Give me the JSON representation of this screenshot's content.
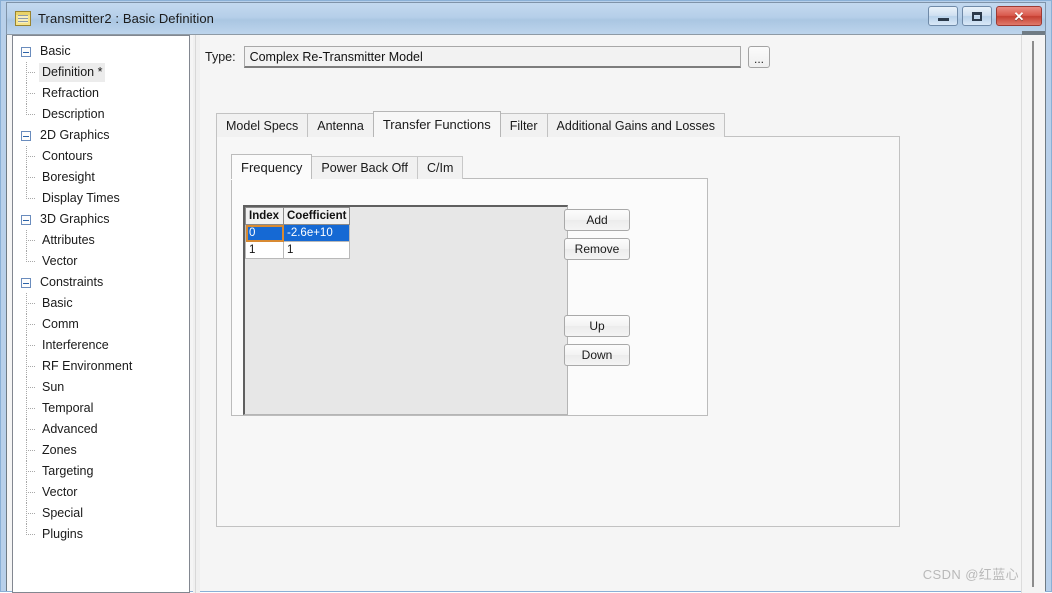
{
  "window": {
    "title": "Transmitter2 : Basic Definition",
    "icon": "notepad-icon",
    "buttons": {
      "minimize": "minimize-icon",
      "maximize": "maximize-icon",
      "close": "✕"
    },
    "frame_color": "#b8d0ea",
    "titlebar_color": "#aac6e2",
    "close_color": "#c53e31"
  },
  "sidebar": {
    "nodes": [
      {
        "label": "Basic",
        "type": "group",
        "expanded": true
      },
      {
        "label": "Definition *",
        "type": "child",
        "selected": true
      },
      {
        "label": "Refraction",
        "type": "child"
      },
      {
        "label": "Description",
        "type": "child",
        "last": true
      },
      {
        "label": "2D Graphics",
        "type": "group",
        "expanded": true
      },
      {
        "label": "Contours",
        "type": "child"
      },
      {
        "label": "Boresight",
        "type": "child"
      },
      {
        "label": "Display Times",
        "type": "child",
        "last": true
      },
      {
        "label": "3D Graphics",
        "type": "group",
        "expanded": true
      },
      {
        "label": "Attributes",
        "type": "child"
      },
      {
        "label": "Vector",
        "type": "child",
        "last": true
      },
      {
        "label": "Constraints",
        "type": "group",
        "expanded": true
      },
      {
        "label": "Basic",
        "type": "child"
      },
      {
        "label": "Comm",
        "type": "child"
      },
      {
        "label": "Interference",
        "type": "child"
      },
      {
        "label": "RF Environment",
        "type": "child"
      },
      {
        "label": "Sun",
        "type": "child"
      },
      {
        "label": "Temporal",
        "type": "child"
      },
      {
        "label": "Advanced",
        "type": "child"
      },
      {
        "label": "Zones",
        "type": "child"
      },
      {
        "label": "Targeting",
        "type": "child"
      },
      {
        "label": "Vector",
        "type": "child"
      },
      {
        "label": "Special",
        "type": "child"
      },
      {
        "label": "Plugins",
        "type": "child",
        "last": true
      }
    ]
  },
  "type_row": {
    "label": "Type:",
    "value": "Complex Re-Transmitter Model",
    "browse_label": "..."
  },
  "tabs": {
    "outer": [
      {
        "label": "Model Specs",
        "active": false
      },
      {
        "label": "Antenna",
        "active": false
      },
      {
        "label": "Transfer Functions",
        "active": true
      },
      {
        "label": "Filter",
        "active": false
      },
      {
        "label": "Additional Gains and Losses",
        "active": false
      }
    ],
    "inner": [
      {
        "label": "Frequency",
        "active": true
      },
      {
        "label": "Power Back Off",
        "active": false
      },
      {
        "label": "C/Im",
        "active": false
      }
    ]
  },
  "grid": {
    "columns": [
      "Index",
      "Coefficient"
    ],
    "rows": [
      {
        "index": "0",
        "coefficient": "-2.6e+10",
        "selected": true
      },
      {
        "index": "1",
        "coefficient": "1",
        "selected": false
      }
    ],
    "selection_color": "#1569d4",
    "focus_color": "#d88a32"
  },
  "buttons": {
    "add": "Add",
    "remove": "Remove",
    "up": "Up",
    "down": "Down"
  },
  "watermark": "CSDN @红蓝心"
}
